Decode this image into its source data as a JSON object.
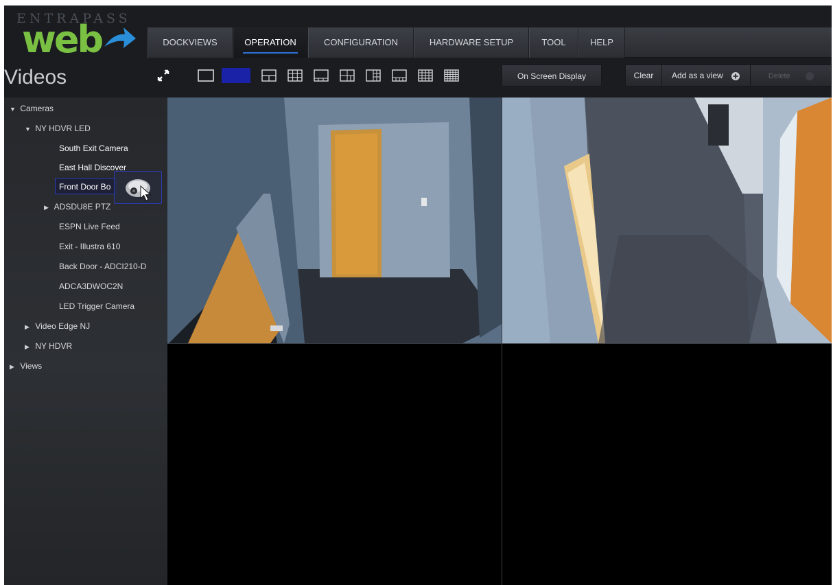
{
  "logo": {
    "top_text": "ENTRAPASS",
    "main_text": "web"
  },
  "page": {
    "title": "Videos"
  },
  "menu": {
    "tabs": [
      {
        "label": "DOCKVIEWS",
        "active": false
      },
      {
        "label": "OPERATION",
        "active": true
      },
      {
        "label": "CONFIGURATION",
        "active": false
      },
      {
        "label": "HARDWARE SETUP",
        "active": false
      },
      {
        "label": "TOOL",
        "active": false
      },
      {
        "label": "HELP",
        "active": false
      }
    ]
  },
  "toolbar": {
    "fullscreen_icon": "expand-icon",
    "layouts": [
      {
        "icon": "layout-1x1-icon",
        "selected": false
      },
      {
        "icon": "layout-2x2-icon",
        "selected": true
      },
      {
        "icon": "layout-1plus3-icon",
        "selected": false
      },
      {
        "icon": "layout-3x3-icon",
        "selected": false
      },
      {
        "icon": "layout-1plus5-icon",
        "selected": false
      },
      {
        "icon": "layout-1plus7-icon",
        "selected": false
      },
      {
        "icon": "layout-2plus8-icon",
        "selected": false
      },
      {
        "icon": "layout-1plus12-icon",
        "selected": false
      },
      {
        "icon": "layout-4x4-icon",
        "selected": false
      },
      {
        "icon": "layout-5x5-icon",
        "selected": false
      }
    ],
    "osd_label": "On Screen Display",
    "clear_label": "Clear",
    "add_view_label": "Add as a view",
    "delete_label": "Delete",
    "accent_color": "#1a22a8"
  },
  "sidebar": {
    "tree": [
      {
        "label": "Cameras",
        "arrow": "▼"
      },
      {
        "label": "NY HDVR LED",
        "arrow": "▼"
      },
      {
        "label": "South Exit Camera",
        "arrow": ""
      },
      {
        "label": "East Hall Discover",
        "arrow": ""
      },
      {
        "label": "Front Door Bo",
        "arrow": ""
      },
      {
        "label": "ADSDU8E PTZ",
        "arrow": "▶"
      },
      {
        "label": "ESPN Live Feed",
        "arrow": ""
      },
      {
        "label": "Exit - Illustra 610",
        "arrow": ""
      },
      {
        "label": "Back Door - ADCI210-D",
        "arrow": ""
      },
      {
        "label": "ADCA3DWOC2N",
        "arrow": ""
      },
      {
        "label": "LED Trigger Camera",
        "arrow": ""
      },
      {
        "label": "Video Edge NJ",
        "arrow": "▶"
      },
      {
        "label": "NY HDVR",
        "arrow": "▶"
      },
      {
        "label": "Views",
        "arrow": "▶"
      }
    ]
  },
  "video_grid": {
    "tiles": [
      {
        "slot": "top-left",
        "content": "hallway-with-orange-door"
      },
      {
        "slot": "top-right",
        "content": "fisheye-corridor"
      },
      {
        "slot": "bottom-left",
        "content": "empty"
      },
      {
        "slot": "bottom-right",
        "content": "empty"
      }
    ]
  }
}
